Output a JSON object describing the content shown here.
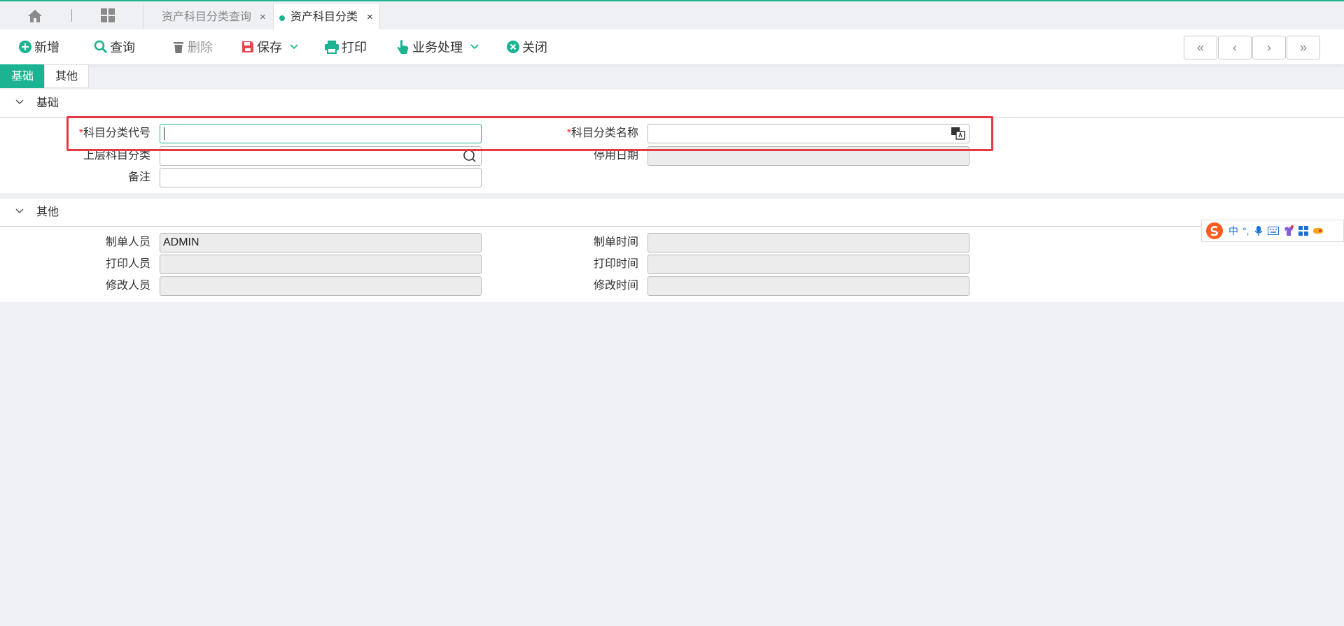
{
  "tabs": {
    "home_icon": "home-icon",
    "grid_icon": "grid-icon",
    "items": [
      {
        "label": "资产科目分类查询",
        "active": false
      },
      {
        "label": "资产科目分类",
        "active": true
      }
    ],
    "close_glyph": "×"
  },
  "toolbar": {
    "add": "新增",
    "query": "查询",
    "delete": "删除",
    "save": "保存",
    "print": "打印",
    "business": "业务处理",
    "close": "关闭",
    "nav": [
      "«",
      "‹",
      "›",
      "»"
    ]
  },
  "section_tabs": [
    "基础",
    "其他"
  ],
  "basic": {
    "title": "基础",
    "fields": {
      "code_label": "科目分类代号",
      "code_value": "",
      "name_label": "科目分类名称",
      "name_value": "",
      "parent_label": "上层科目分类",
      "parent_value": "",
      "disable_date_label": "停用日期",
      "disable_date_value": "",
      "remark_label": "备注",
      "remark_value": ""
    },
    "required_mark": "*"
  },
  "other": {
    "title": "其他",
    "fields": {
      "creator_label": "制单人员",
      "creator_value": "ADMIN",
      "create_time_label": "制单时间",
      "create_time_value": "",
      "printer_label": "打印人员",
      "printer_value": "",
      "print_time_label": "打印时间",
      "print_time_value": "",
      "modifier_label": "修改人员",
      "modifier_value": "",
      "modify_time_label": "修改时间",
      "modify_time_value": ""
    }
  },
  "ime": {
    "lang": "中",
    "punct": "°,"
  },
  "colors": {
    "accent": "#1bb392",
    "required": "#e33333",
    "highlight": "#e63946"
  }
}
